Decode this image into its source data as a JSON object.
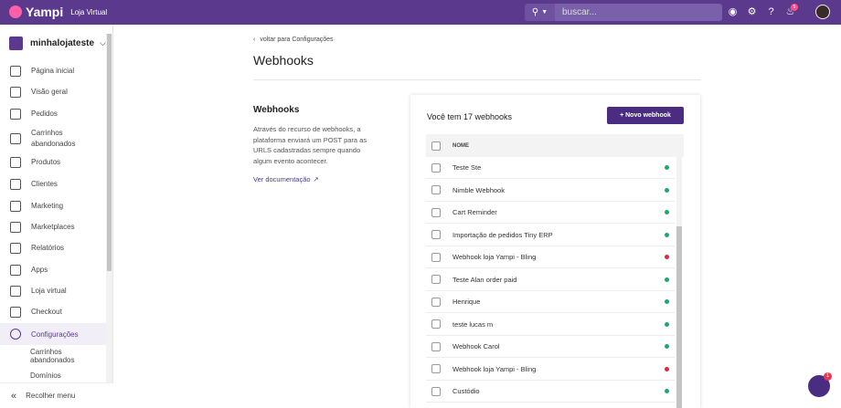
{
  "topbar": {
    "brand": "Yampi",
    "brand_sub": "Loja Virtual",
    "search_placeholder": "buscar...",
    "notification_count": "5"
  },
  "sidebar": {
    "store_name": "minhalojateste",
    "items": [
      {
        "label": "Página inicial"
      },
      {
        "label": "Visão geral"
      },
      {
        "label": "Pedidos"
      },
      {
        "label": "Carrinhos abandonados"
      },
      {
        "label": "Produtos"
      },
      {
        "label": "Clientes"
      },
      {
        "label": "Marketing"
      },
      {
        "label": "Marketplaces"
      },
      {
        "label": "Relatórios"
      },
      {
        "label": "Apps"
      },
      {
        "label": "Loja virtual"
      },
      {
        "label": "Checkout"
      },
      {
        "label": "Configurações"
      }
    ],
    "subitems": [
      "Carrinhos abandonados",
      "Domínios"
    ],
    "collapse_label": "Recolher menu"
  },
  "main": {
    "back_link": "voltar para Configurações",
    "title": "Webhooks",
    "section_title": "Webhooks",
    "description": "Através do recurso de webhooks, a plataforma enviará um POST para as URLS cadastradas sempre quando algum evento acontecer.",
    "doc_link": "Ver documentação"
  },
  "card": {
    "count_text": "Você tem 17 webhooks",
    "new_button": "+ Novo webhook",
    "column_name": "NOME",
    "rows": [
      {
        "name": "Teste Ste",
        "status": "#1aaa6a"
      },
      {
        "name": "Nimble Webhook",
        "status": "#1aaa6a"
      },
      {
        "name": "Cart Reminder",
        "status": "#1aaa6a"
      },
      {
        "name": "Importação de pedidos Tiny ERP",
        "status": "#1aaa6a"
      },
      {
        "name": "Webhook loja Yampi - Bling",
        "status": "#e0283c"
      },
      {
        "name": "Teste Alan order paid",
        "status": "#1aaa6a"
      },
      {
        "name": "Henrique",
        "status": "#1aaa6a"
      },
      {
        "name": "teste lucas m",
        "status": "#1aaa6a"
      },
      {
        "name": "Webhook Carol",
        "status": "#1aaa6a"
      },
      {
        "name": "Webhook loja Yampi - Bling",
        "status": "#e0283c"
      },
      {
        "name": "Custódio",
        "status": "#1aaa6a"
      }
    ]
  },
  "chat": {
    "badge": "1"
  }
}
